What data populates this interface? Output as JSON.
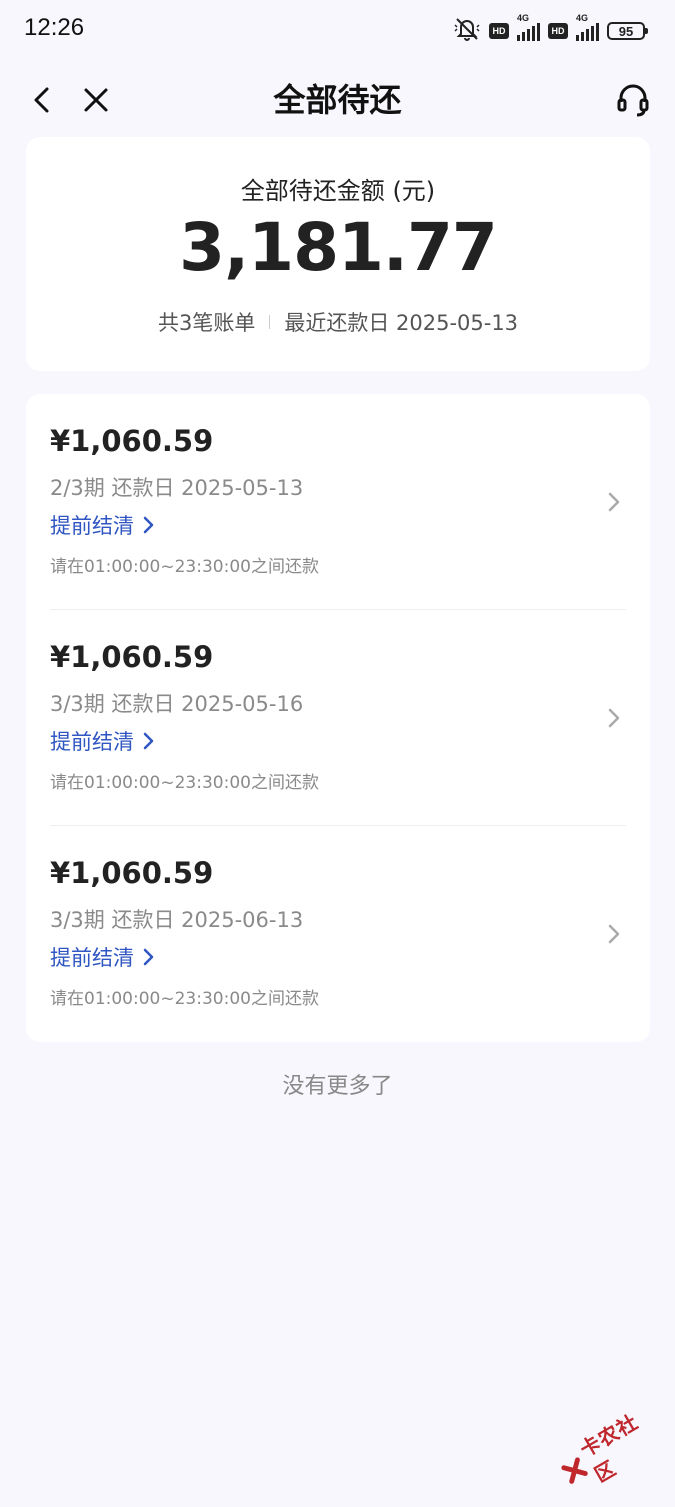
{
  "status_bar": {
    "time": "12:26",
    "network_1": "4G",
    "network_2": "4G",
    "hd_label": "HD",
    "battery": "95"
  },
  "nav": {
    "title": "全部待还"
  },
  "summary": {
    "label": "全部待还金额 (元)",
    "amount": "3,181.77",
    "bill_count": "共3笔账单",
    "recent_due": "最近还款日 2025-05-13"
  },
  "bills": [
    {
      "amount": "¥1,060.59",
      "period": "2/3期 还款日 2025-05-13",
      "action": "提前结清",
      "note": "请在01:00:00~23:30:00之间还款"
    },
    {
      "amount": "¥1,060.59",
      "period": "3/3期 还款日 2025-05-16",
      "action": "提前结清",
      "note": "请在01:00:00~23:30:00之间还款"
    },
    {
      "amount": "¥1,060.59",
      "period": "3/3期 还款日 2025-06-13",
      "action": "提前结清",
      "note": "请在01:00:00~23:30:00之间还款"
    }
  ],
  "footer": "没有更多了",
  "watermark": "卡农社区",
  "colors": {
    "accent": "#2f56c2",
    "background": "#f7f7fd",
    "watermark": "#c0272d"
  }
}
